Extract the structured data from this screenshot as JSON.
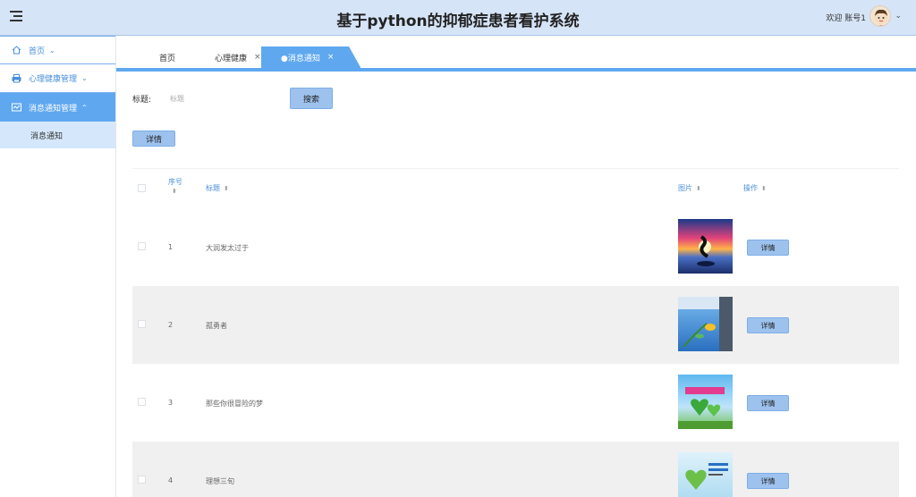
{
  "header": {
    "title": "基于python的抑郁症患者看护系统",
    "welcome": "欢迎 账号1"
  },
  "sidebar": {
    "items": [
      {
        "label": "首页",
        "icon": "home-icon"
      },
      {
        "label": "心理健康管理",
        "icon": "printer-icon"
      },
      {
        "label": "消息通知管理",
        "icon": "message-icon"
      }
    ],
    "sub_item": "消息通知"
  },
  "tabs": [
    {
      "label": "首页"
    },
    {
      "label": "心理健康",
      "close": "×"
    },
    {
      "label": "●消息通知",
      "close": "×"
    }
  ],
  "search": {
    "label": "标题:",
    "placeholder": "标题",
    "button": "搜索"
  },
  "toolbar": {
    "detail_label": "详情"
  },
  "table": {
    "columns": {
      "index": "序号",
      "title": "标题",
      "image": "图片",
      "action": "操作"
    },
    "rows": [
      {
        "index": "1",
        "title": "大润发太过于",
        "action": "详情"
      },
      {
        "index": "2",
        "title": "孤勇者",
        "action": "详情"
      },
      {
        "index": "3",
        "title": "那些你很冒险的梦",
        "action": "详情"
      },
      {
        "index": "4",
        "title": "理想三旬",
        "action": "详情"
      }
    ]
  },
  "colors": {
    "accent": "#5fa8f0",
    "header_bg": "#d6e4f7",
    "button_bg": "#9dc2ee"
  }
}
